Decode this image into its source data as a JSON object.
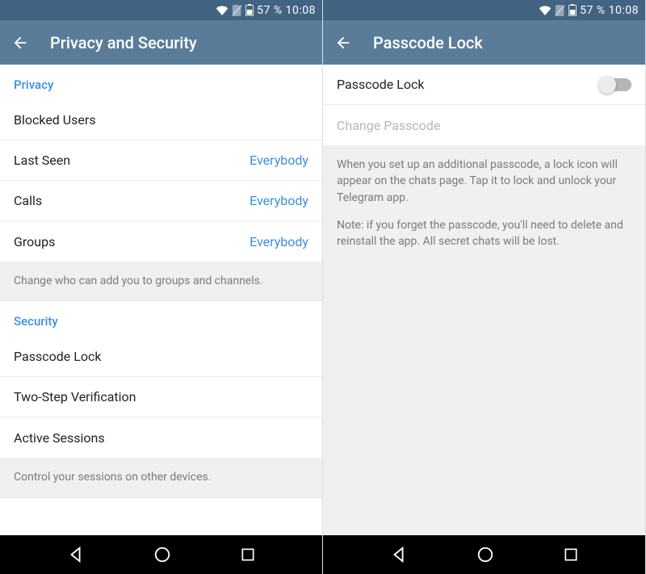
{
  "status": {
    "battery_pct": "57 %",
    "time": "10:08"
  },
  "left": {
    "title": "Privacy and Security",
    "section_privacy": "Privacy",
    "blocked_users": "Blocked Users",
    "last_seen": {
      "label": "Last Seen",
      "value": "Everybody"
    },
    "calls": {
      "label": "Calls",
      "value": "Everybody"
    },
    "groups": {
      "label": "Groups",
      "value": "Everybody"
    },
    "groups_note": "Change who can add you to groups and channels.",
    "section_security": "Security",
    "passcode_lock": "Passcode Lock",
    "two_step": "Two-Step Verification",
    "active_sessions": "Active Sessions",
    "sessions_note": "Control your sessions on other devices."
  },
  "right": {
    "title": "Passcode Lock",
    "passcode_lock": "Passcode Lock",
    "change_passcode": "Change Passcode",
    "info1": "When you set up an additional passcode, a lock icon will appear on the chats page. Tap it to lock and unlock your Telegram app.",
    "info2": "Note: if you forget the passcode, you'll need to delete and reinstall the app. All secret chats will be lost."
  }
}
